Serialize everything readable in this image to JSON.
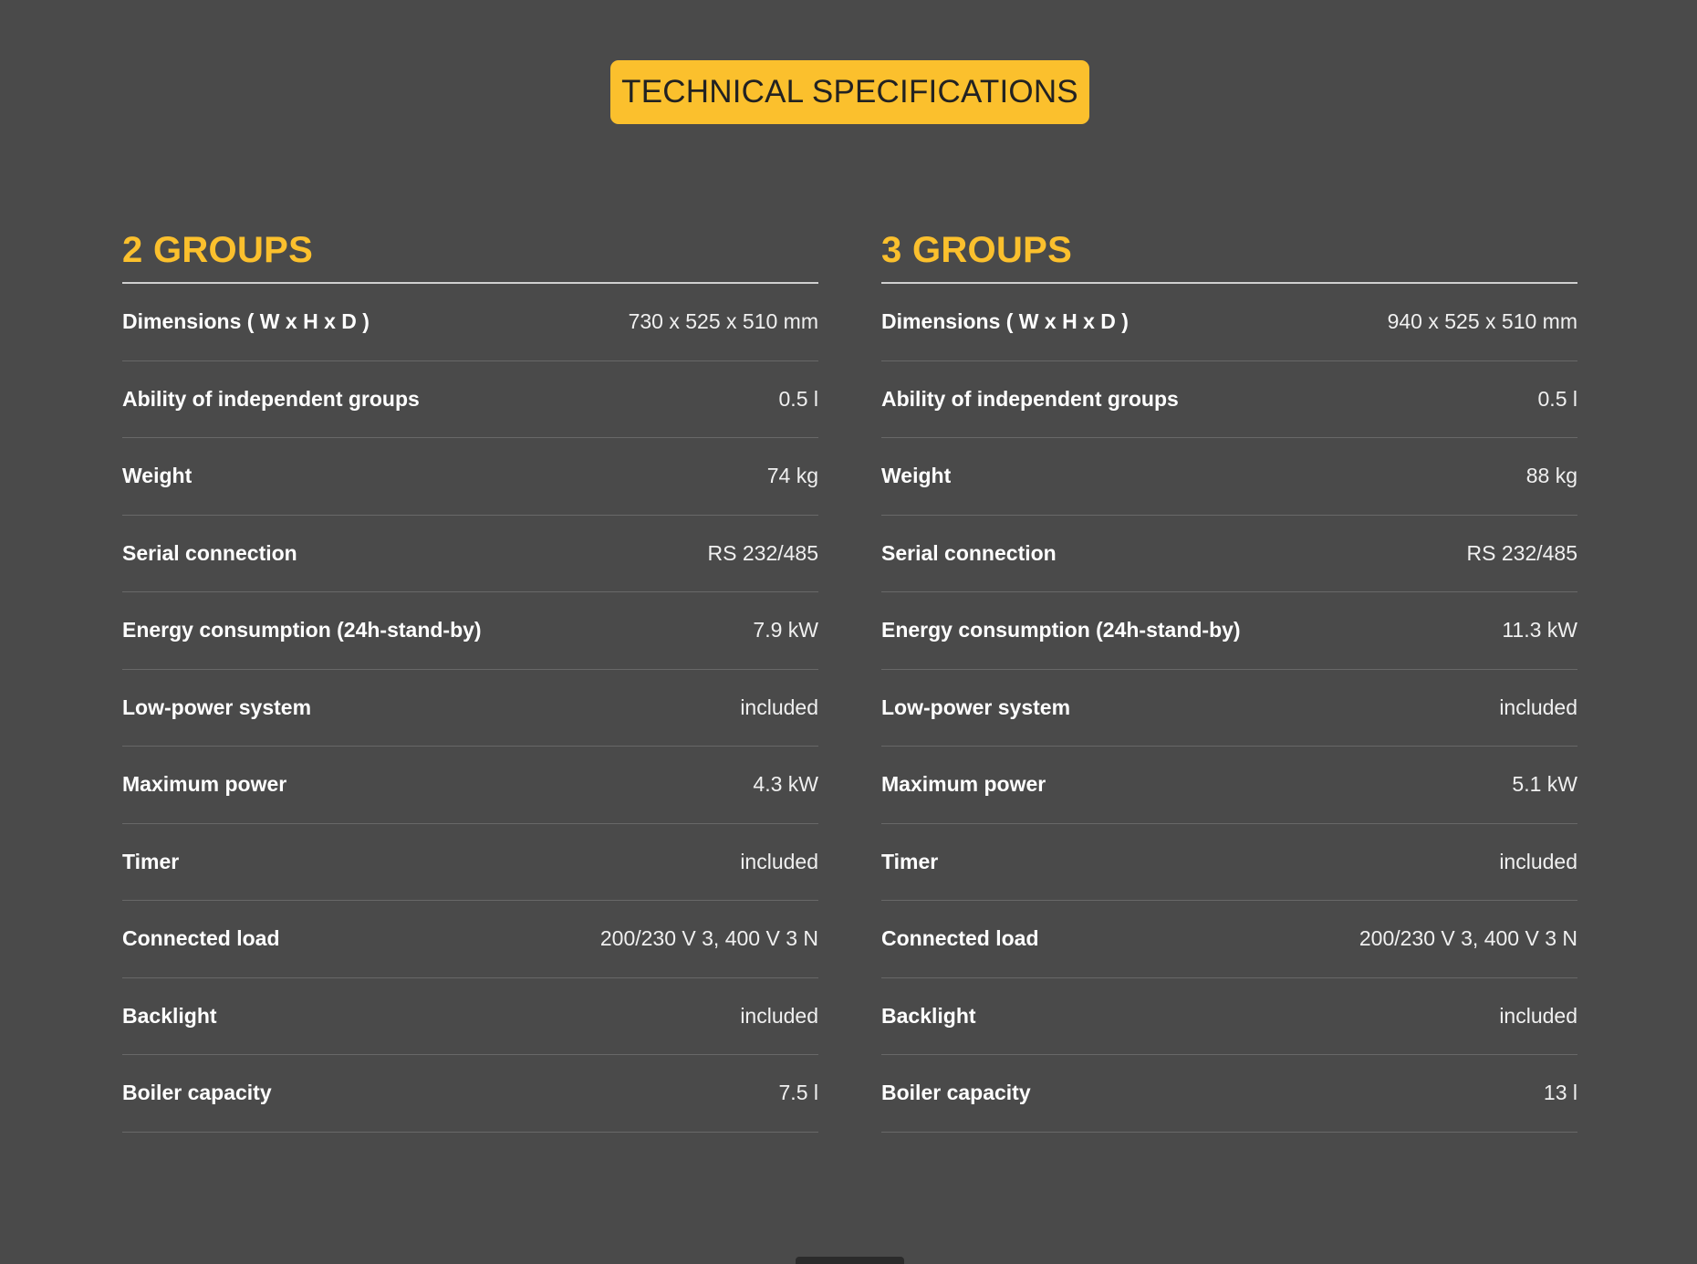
{
  "header": {
    "title": "TECHNICAL SPECIFICATIONS"
  },
  "colors": {
    "background": "#4a4a4a",
    "accent": "#fbc02d",
    "text": "#ffffff",
    "divider": "#686868"
  },
  "groups": [
    {
      "title": "2 GROUPS",
      "specs": [
        {
          "label": "Dimensions ( W x H x D )",
          "value": "730 x 525 x 510 mm"
        },
        {
          "label": "Ability of independent groups",
          "value": "0.5 l"
        },
        {
          "label": "Weight",
          "value": "74 kg"
        },
        {
          "label": "Serial connection",
          "value": "RS 232/485"
        },
        {
          "label": "Energy consumption (24h-stand-by)",
          "value": "7.9 kW"
        },
        {
          "label": "Low-power system",
          "value": "included"
        },
        {
          "label": "Maximum power",
          "value": "4.3 kW"
        },
        {
          "label": "Timer",
          "value": "included"
        },
        {
          "label": "Connected load",
          "value": "200/230 V 3, 400 V 3 N"
        },
        {
          "label": "Backlight",
          "value": "included"
        },
        {
          "label": "Boiler capacity",
          "value": "7.5 l"
        }
      ]
    },
    {
      "title": "3 GROUPS",
      "specs": [
        {
          "label": "Dimensions ( W x H x D )",
          "value": "940 x 525 x 510 mm"
        },
        {
          "label": "Ability of independent groups",
          "value": "0.5 l"
        },
        {
          "label": "Weight",
          "value": "88 kg"
        },
        {
          "label": "Serial connection",
          "value": "RS 232/485"
        },
        {
          "label": "Energy consumption (24h-stand-by)",
          "value": "11.3 kW"
        },
        {
          "label": "Low-power system",
          "value": "included"
        },
        {
          "label": "Maximum power",
          "value": "5.1 kW"
        },
        {
          "label": "Timer",
          "value": "included"
        },
        {
          "label": "Connected load",
          "value": "200/230 V 3, 400 V 3 N"
        },
        {
          "label": "Backlight",
          "value": "included"
        },
        {
          "label": "Boiler capacity",
          "value": "13 l"
        }
      ]
    }
  ]
}
